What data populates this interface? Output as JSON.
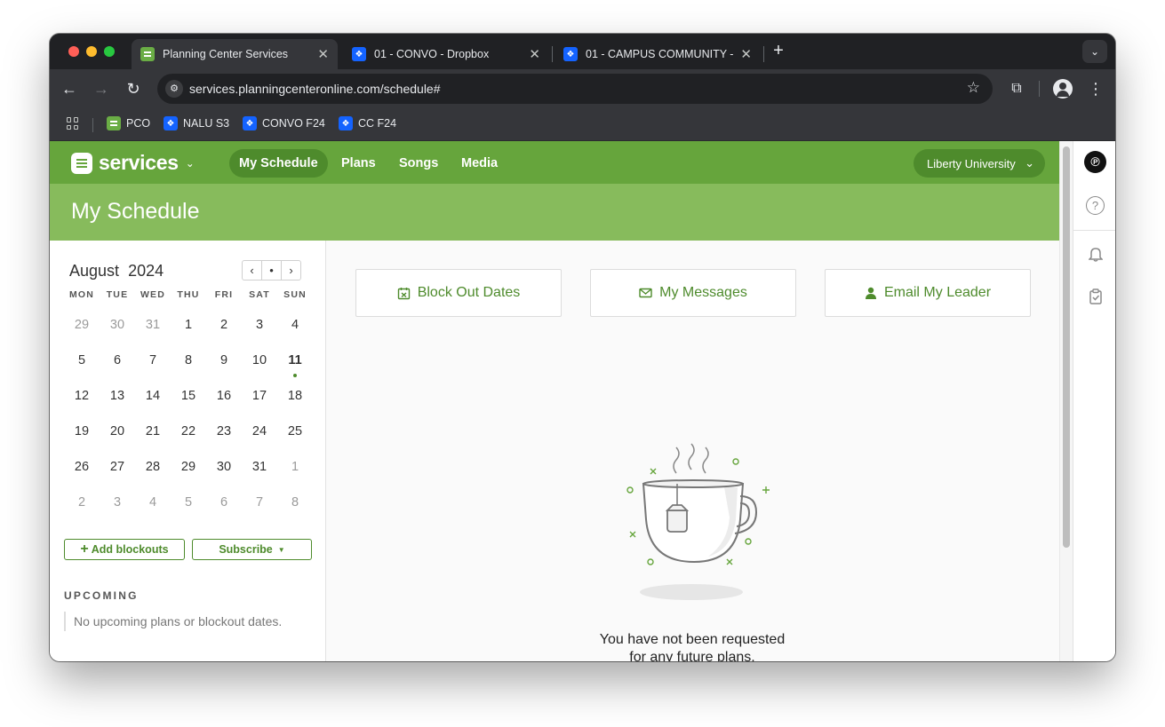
{
  "browser": {
    "tabs": [
      {
        "title": "Planning Center Services",
        "favicon": "planning-center-icon",
        "active": true
      },
      {
        "title": "01 - CONVO - Dropbox",
        "favicon": "dropbox-icon",
        "active": false
      },
      {
        "title": "01 - CAMPUS COMMUNITY - ",
        "favicon": "dropbox-icon",
        "active": false
      }
    ],
    "url": "services.planningcenteronline.com/schedule#",
    "bookmarks": [
      {
        "label": "PCO",
        "favicon": "planning-center-icon"
      },
      {
        "label": "NALU S3",
        "favicon": "dropbox-icon"
      },
      {
        "label": "CONVO F24",
        "favicon": "dropbox-icon"
      },
      {
        "label": "CC F24",
        "favicon": "dropbox-icon"
      }
    ]
  },
  "app": {
    "logo_text": "services",
    "nav": [
      {
        "label": "My Schedule",
        "active": true
      },
      {
        "label": "Plans",
        "active": false
      },
      {
        "label": "Songs",
        "active": false
      },
      {
        "label": "Media",
        "active": false
      }
    ],
    "organization": "Liberty University",
    "page_title": "My Schedule",
    "accent_color": "#66a53c",
    "header_color": "#87bb5c"
  },
  "calendar": {
    "month": "August",
    "year": "2024",
    "weekdays": [
      "MON",
      "TUE",
      "WED",
      "THU",
      "FRI",
      "SAT",
      "SUN"
    ],
    "weeks": [
      [
        "29",
        "30",
        "31",
        "1",
        "2",
        "3",
        "4"
      ],
      [
        "5",
        "6",
        "7",
        "8",
        "9",
        "10",
        "11"
      ],
      [
        "12",
        "13",
        "14",
        "15",
        "16",
        "17",
        "18"
      ],
      [
        "19",
        "20",
        "21",
        "22",
        "23",
        "24",
        "25"
      ],
      [
        "26",
        "27",
        "28",
        "29",
        "30",
        "31",
        "1"
      ],
      [
        "2",
        "3",
        "4",
        "5",
        "6",
        "7",
        "8"
      ]
    ],
    "today": "11"
  },
  "sidebar": {
    "add_blockouts": "Add blockouts",
    "subscribe": "Subscribe",
    "upcoming_label": "UPCOMING",
    "upcoming_empty": "No upcoming plans or blockout dates."
  },
  "main": {
    "actions": [
      {
        "label": "Block Out Dates",
        "icon": "calendar-x-icon"
      },
      {
        "label": "My Messages",
        "icon": "envelope-icon"
      },
      {
        "label": "Email My Leader",
        "icon": "person-icon"
      }
    ],
    "empty_message_line1": "You have not been requested",
    "empty_message_line2": "for any future plans."
  }
}
